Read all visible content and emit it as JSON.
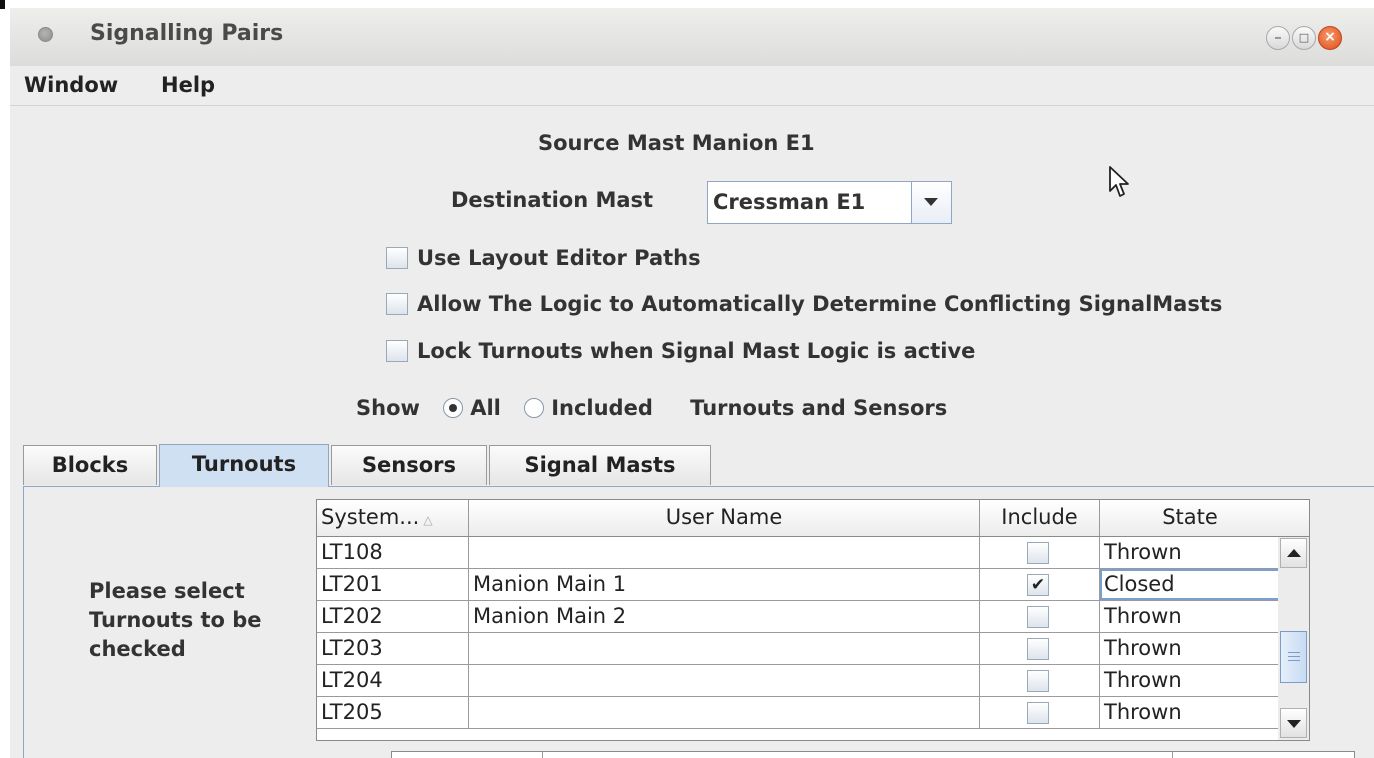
{
  "window": {
    "title": "Signalling Pairs",
    "controls": {
      "minimize": "–",
      "maximize": "□",
      "close": "×"
    }
  },
  "menubar": {
    "items": [
      "Window",
      "Help"
    ]
  },
  "source": {
    "label": "Source Mast Manion E1"
  },
  "destination": {
    "label": "Destination Mast",
    "value": "Cressman E1"
  },
  "options": [
    {
      "label": "Use Layout Editor Paths",
      "checked": false
    },
    {
      "label": "Allow The Logic to Automatically Determine Conflicting SignalMasts",
      "checked": false
    },
    {
      "label": "Lock Turnouts when Signal Mast Logic is active",
      "checked": false
    }
  ],
  "show": {
    "label": "Show",
    "options": [
      {
        "label": "All",
        "selected": true
      },
      {
        "label": "Included",
        "selected": false
      }
    ],
    "suffix": "Turnouts and Sensors"
  },
  "tabs": [
    {
      "label": "Blocks",
      "active": false
    },
    {
      "label": "Turnouts",
      "active": true
    },
    {
      "label": "Sensors",
      "active": false
    },
    {
      "label": "Signal Masts",
      "active": false
    }
  ],
  "prompt": {
    "line1": "Please select",
    "line2": "Turnouts to be",
    "line3": "checked"
  },
  "table": {
    "headers": {
      "system": "System...",
      "user": "User Name",
      "include": "Include",
      "state": "State"
    },
    "rows": [
      {
        "system": "LT108",
        "user": "",
        "include": "",
        "state": "Thrown"
      },
      {
        "system": "LT201",
        "user": "Manion Main 1",
        "include": "✔",
        "state": "Closed"
      },
      {
        "system": "LT202",
        "user": "Manion Main 2",
        "include": "",
        "state": "Thrown"
      },
      {
        "system": "LT203",
        "user": "",
        "include": "",
        "state": "Thrown"
      },
      {
        "system": "LT204",
        "user": "",
        "include": "",
        "state": "Thrown"
      },
      {
        "system": "LT205",
        "user": "",
        "include": "",
        "state": "Thrown"
      }
    ]
  },
  "icons": {
    "title_dot": "window-menu-icon",
    "sort": "sort-ascending-icon",
    "combo_arrow": "chevron-down-icon",
    "cursor": "mouse-pointer-icon"
  },
  "colors": {
    "active_tab": "#cfe0f3",
    "close_button": "#df4b17",
    "accent_border": "#8fa7c4"
  }
}
